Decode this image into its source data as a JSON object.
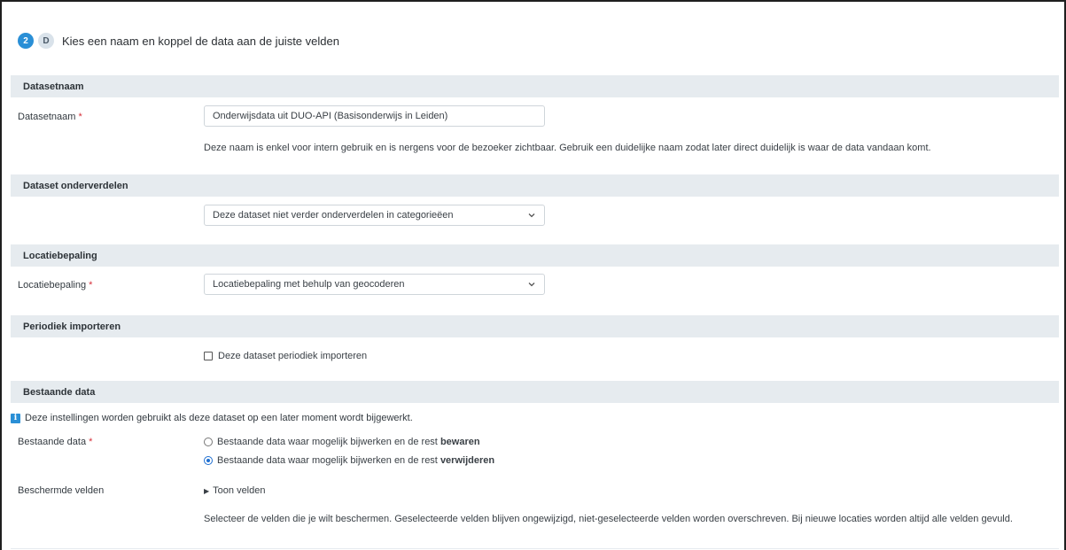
{
  "header": {
    "step_number": "2",
    "step_letter": "D",
    "title": "Kies een naam en koppel de data aan de juiste velden"
  },
  "sections": {
    "datasetnaam": {
      "heading": "Datasetnaam",
      "label": "Datasetnaam",
      "required_mark": "*",
      "input_value": "Onderwijsdata uit DUO-API (Basisonderwijs in Leiden)",
      "help": "Deze naam is enkel voor intern gebruik en is nergens voor de bezoeker zichtbaar. Gebruik een duidelijke naam zodat later direct duidelijk is waar de data vandaan komt."
    },
    "onderverdelen": {
      "heading": "Dataset onderverdelen",
      "select_value": "Deze dataset niet verder onderverdelen in categorieëen"
    },
    "locatie": {
      "heading": "Locatiebepaling",
      "label": "Locatiebepaling",
      "required_mark": "*",
      "select_value": "Locatiebepaling met behulp van geocoderen"
    },
    "periodiek": {
      "heading": "Periodiek importeren",
      "checkbox_label": "Deze dataset periodiek importeren",
      "checked": false
    },
    "bestaand": {
      "heading": "Bestaande data",
      "info": "Deze instellingen worden gebruikt als deze dataset op een later moment wordt bijgewerkt.",
      "label": "Bestaande data",
      "required_mark": "*",
      "option1_prefix": "Bestaande data waar mogelijk bijwerken en de rest",
      "option1_bold": "bewaren",
      "option2_prefix": "Bestaande data waar mogelijk bijwerken en de rest",
      "option2_bold": "verwijderen",
      "selected_option": 2,
      "protected_label": "Beschermde velden",
      "toggle_label": "Toon velden",
      "protected_help": "Selecteer de velden die je wilt beschermen. Geselecteerde velden blijven ongewijzigd, niet-geselecteerde velden worden overschreven. Bij nieuwe locaties worden altijd alle velden gevuld."
    }
  },
  "icons": {
    "select_chevron": "chevron-down-icon",
    "info": "info-icon",
    "disclosure": "triangle-right-icon"
  },
  "colors": {
    "accent": "#2a8fd6",
    "required": "#d6303a",
    "section_bg": "#e6ebef"
  }
}
